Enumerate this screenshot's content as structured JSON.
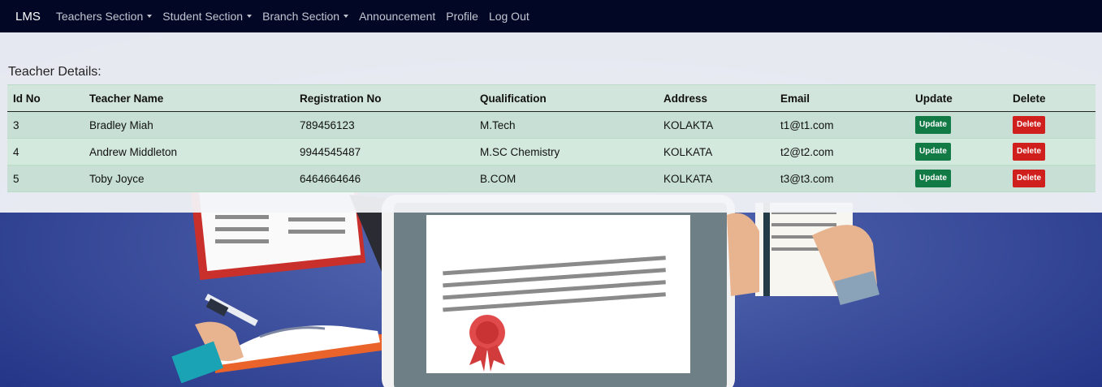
{
  "nav": {
    "brand": "LMS",
    "items": [
      {
        "label": "Teachers Section",
        "dropdown": true
      },
      {
        "label": "Student Section",
        "dropdown": true
      },
      {
        "label": "Branch Section",
        "dropdown": true
      },
      {
        "label": "Announcement",
        "dropdown": false
      },
      {
        "label": "Profile",
        "dropdown": false
      },
      {
        "label": "Log Out",
        "dropdown": false
      }
    ]
  },
  "page": {
    "title": "Teacher Details:"
  },
  "table": {
    "headers": [
      "Id No",
      "Teacher Name",
      "Registration No",
      "Qualification",
      "Address",
      "Email",
      "Update",
      "Delete"
    ],
    "rows": [
      {
        "id": "3",
        "name": "Bradley Miah",
        "reg": "789456123",
        "qual": "M.Tech",
        "address": "KOLAKTA",
        "email": "t1@t1.com",
        "update": "Update",
        "delete": "Delete"
      },
      {
        "id": "4",
        "name": "Andrew Middleton",
        "reg": "9944545487",
        "qual": "M.SC Chemistry",
        "address": "KOLKATA",
        "email": "t2@t2.com",
        "update": "Update",
        "delete": "Delete"
      },
      {
        "id": "5",
        "name": "Toby Joyce",
        "reg": "6464664646",
        "qual": "B.COM",
        "address": "KOLKATA",
        "email": "t3@t3.com",
        "update": "Update",
        "delete": "Delete"
      }
    ]
  },
  "colors": {
    "navbar": "#020726",
    "header_row": "#d2e5dc",
    "update_button": "#117a45",
    "delete_button": "#d0201d",
    "background_blue": "#2a3a8c"
  }
}
